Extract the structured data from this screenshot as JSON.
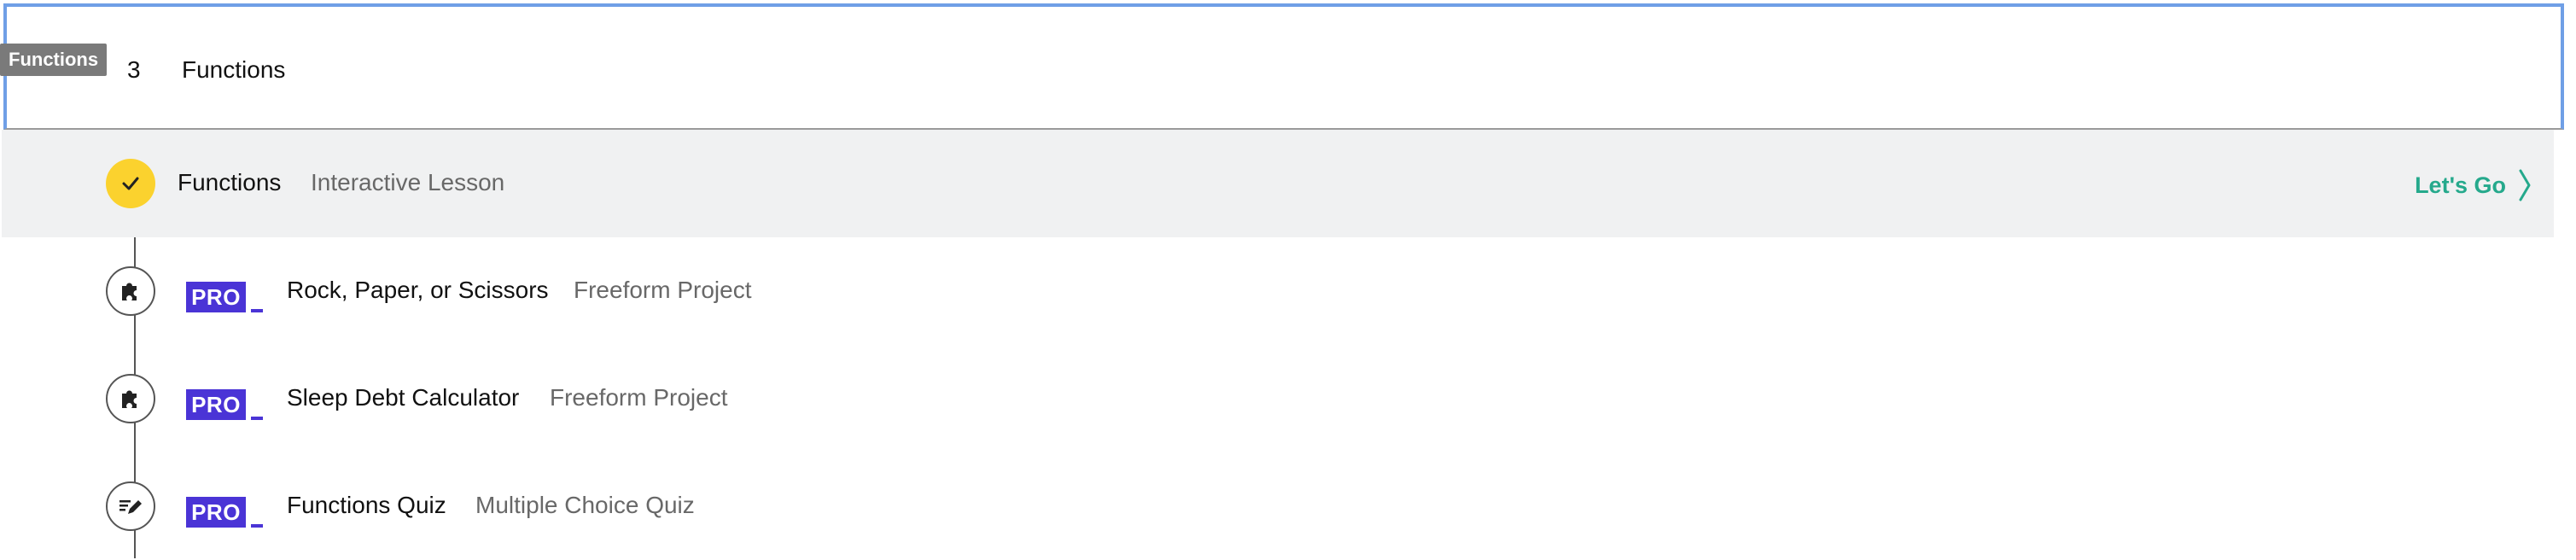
{
  "tooltip": "Functions",
  "section": {
    "number": "3",
    "title": "Functions"
  },
  "items": [
    {
      "title": "Functions",
      "type": "Interactive Lesson",
      "status": "completed",
      "icon": "check-icon",
      "cta": "Let's Go"
    },
    {
      "badge": "PRO",
      "title": "Rock, Paper, or Scissors",
      "type": "Freeform Project",
      "icon": "puzzle-icon"
    },
    {
      "badge": "PRO",
      "title": "Sleep Debt Calculator",
      "type": "Freeform Project",
      "icon": "puzzle-icon"
    },
    {
      "badge": "PRO",
      "title": "Functions Quiz",
      "type": "Multiple Choice Quiz",
      "icon": "quiz-pencil-icon"
    }
  ],
  "colors": {
    "accent_blue": "#6f9fe6",
    "completed_yellow": "#fbd22e",
    "pro_purple": "#4a34d6",
    "cta_green": "#25a98c",
    "active_row_bg": "#f0f1f2"
  }
}
